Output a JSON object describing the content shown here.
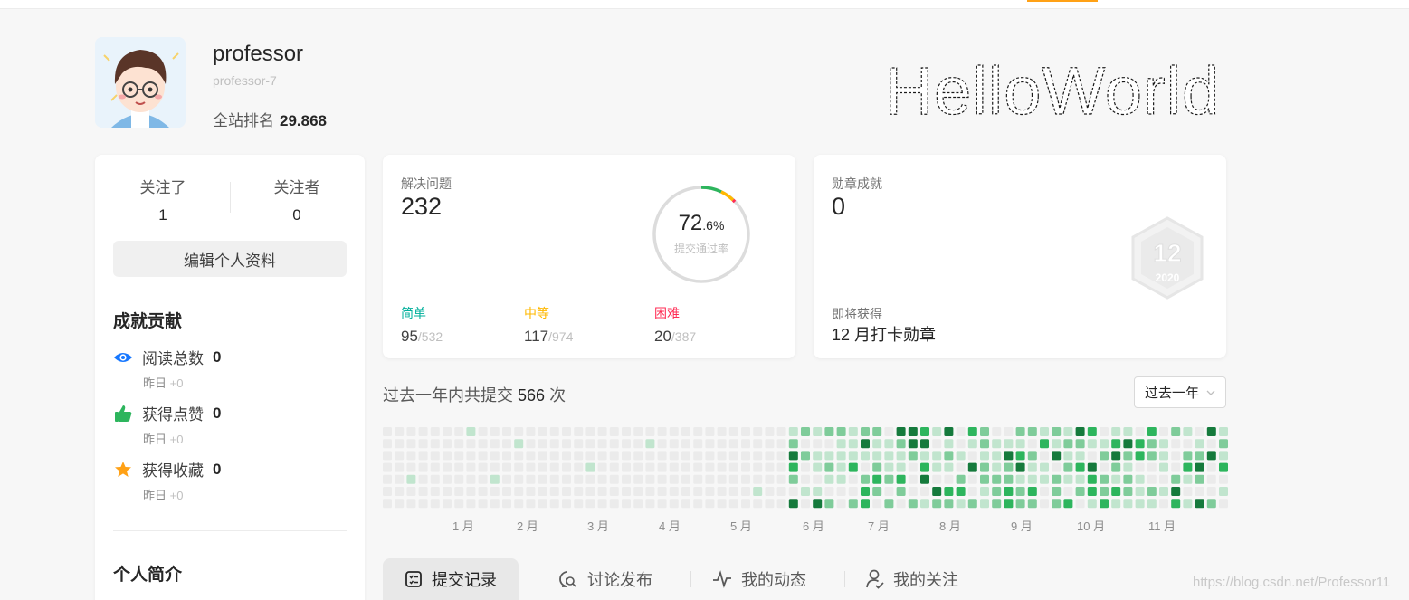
{
  "profile": {
    "username": "professor",
    "user_id": "professor-7",
    "rank_label": "全站排名",
    "rank_value": "29.868",
    "banner_text": "HelloWorld"
  },
  "follow": {
    "following_label": "关注了",
    "following_count": "1",
    "followers_label": "关注者",
    "followers_count": "0",
    "edit_button": "编辑个人资料"
  },
  "contributions": {
    "title": "成就贡献",
    "items": [
      {
        "icon": "eye-icon",
        "label": "阅读总数",
        "value": "0",
        "sub_label": "昨日",
        "sub_value": "+0"
      },
      {
        "icon": "thumbs-up-icon",
        "label": "获得点赞",
        "value": "0",
        "sub_label": "昨日",
        "sub_value": "+0"
      },
      {
        "icon": "star-icon",
        "label": "获得收藏",
        "value": "0",
        "sub_label": "昨日",
        "sub_value": "+0"
      }
    ],
    "bio_title": "个人简介"
  },
  "solved": {
    "label": "解决问题",
    "count": "232",
    "rate_main": "72",
    "rate_decimal": ".6%",
    "rate_label": "提交通过率",
    "easy": {
      "label": "简单",
      "solved": "95",
      "total": "/532",
      "color": "#00af9b"
    },
    "medium": {
      "label": "中等",
      "solved": "117",
      "total": "/974",
      "color": "#ffb800"
    },
    "hard": {
      "label": "困难",
      "solved": "20",
      "total": "/387",
      "color": "#ff2d55"
    }
  },
  "badge": {
    "label": "勋章成就",
    "count": "0",
    "upcoming_label": "即将获得",
    "upcoming_name": "12 月打卡勋章",
    "badge_number": "12",
    "badge_year": "2020"
  },
  "submissions": {
    "prefix": "过去一年内共提交",
    "count": "566",
    "suffix": "次",
    "range_select": "过去一年",
    "months": [
      "1 月",
      "2 月",
      "3 月",
      "4 月",
      "5 月",
      "6 月",
      "7 月",
      "8 月",
      "9 月",
      "10 月",
      "11 月"
    ]
  },
  "tabs": [
    {
      "icon": "checklist-icon",
      "label": "提交记录",
      "active": true
    },
    {
      "icon": "discussion-icon",
      "label": "讨论发布",
      "active": false
    },
    {
      "icon": "activity-icon",
      "label": "我的动态",
      "active": false
    },
    {
      "icon": "user-check-icon",
      "label": "我的关注",
      "active": false
    }
  ],
  "watermark": "https://blog.csdn.net/Professor11",
  "colors": {
    "accent": "#ffa116",
    "heat_levels": [
      "#ebebeb",
      "#c1e5ce",
      "#7fcc9a",
      "#2db55d",
      "#157a3c"
    ]
  }
}
